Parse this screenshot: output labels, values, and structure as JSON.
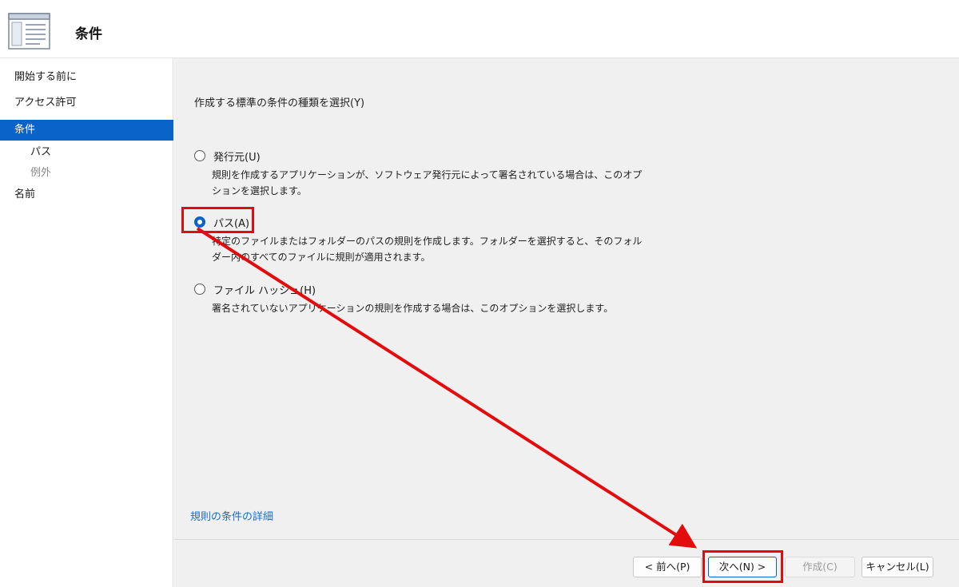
{
  "header": {
    "title": "条件"
  },
  "sidebar": {
    "items": [
      {
        "label": "開始する前に"
      },
      {
        "label": "アクセス許可"
      },
      {
        "label": "条件"
      },
      {
        "label": "パス"
      },
      {
        "label": "例外"
      },
      {
        "label": "名前"
      }
    ],
    "selected": "条件"
  },
  "main": {
    "prompt": "作成する標準の条件の種類を選択(Y)",
    "options": [
      {
        "label": "発行元(U)",
        "description": "規則を作成するアプリケーションが、ソフトウェア発行元によって署名されている場合は、このオプションを選択します。",
        "checked": false
      },
      {
        "label": "パス(A)",
        "description": "特定のファイルまたはフォルダーのパスの規則を作成します。フォルダーを選択すると、そのフォルダー内のすべてのファイルに規則が適用されます。",
        "checked": true
      },
      {
        "label": "ファイル ハッシュ(H)",
        "description": "署名されていないアプリケーションの規則を作成する場合は、このオプションを選択します。",
        "checked": false
      }
    ],
    "details_link": "規則の条件の詳細"
  },
  "buttons": {
    "prev": "< 前へ(P)",
    "next": "次へ(N) >",
    "create": "作成(C)",
    "cancel": "キャンセル(L)"
  },
  "colors": {
    "accent": "#0a63c9",
    "annotation": "#e30b0b",
    "content_bg": "#f0f0f0"
  }
}
